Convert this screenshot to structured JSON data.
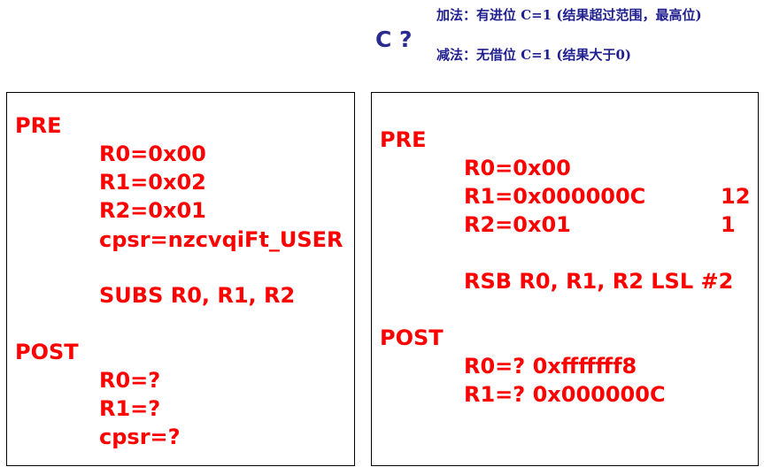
{
  "notes": {
    "carry": "加法：有进位 C=1 (结果超过范围，最高位)",
    "question": "C ?",
    "borrow": "减法：无借位 C=1 (结果大于0)"
  },
  "left": {
    "pre": "PRE",
    "lines": [
      "R0=0x00",
      "R1=0x02",
      "R2=0x01",
      "cpsr=nzcvqiFt_USER"
    ],
    "instr": "SUBS  R0, R1, R2",
    "post": "POST",
    "post_lines": [
      "R0=?",
      "R1=?",
      "cpsr=?"
    ]
  },
  "right": {
    "pre": "PRE",
    "lines": [
      "R0=0x00",
      "R1=0x000000C",
      "R2=0x01"
    ],
    "comments": [
      "12",
      "1"
    ],
    "instr": "RSB  R0, R1, R2 LSL  #2",
    "post": "POST",
    "post_lines": [
      "R0=? 0xfffffff8",
      "R1=? 0x000000C"
    ]
  }
}
